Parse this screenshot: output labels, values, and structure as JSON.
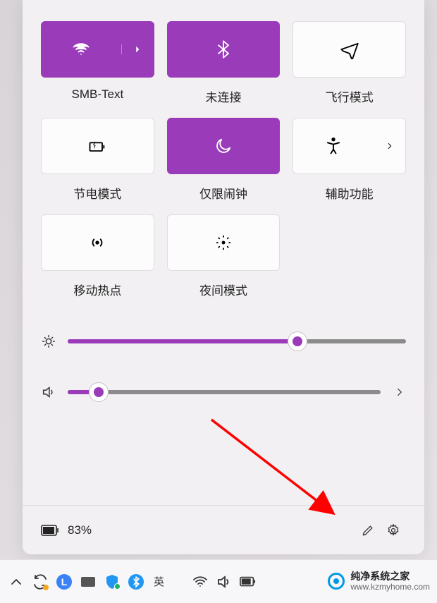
{
  "tiles": [
    {
      "label": "SMB-Text"
    },
    {
      "label": "未连接"
    },
    {
      "label": "飞行模式"
    },
    {
      "label": "节电模式"
    },
    {
      "label": "仅限闹钟"
    },
    {
      "label": "辅助功能"
    },
    {
      "label": "移动热点"
    },
    {
      "label": "夜间模式"
    }
  ],
  "sliders": {
    "brightness": 68,
    "volume": 10
  },
  "footer": {
    "battery_text": "83%"
  },
  "taskbar": {
    "ime": "英"
  },
  "watermark": {
    "title": "纯净系统之家",
    "url": "www.kzmyhome.com"
  }
}
